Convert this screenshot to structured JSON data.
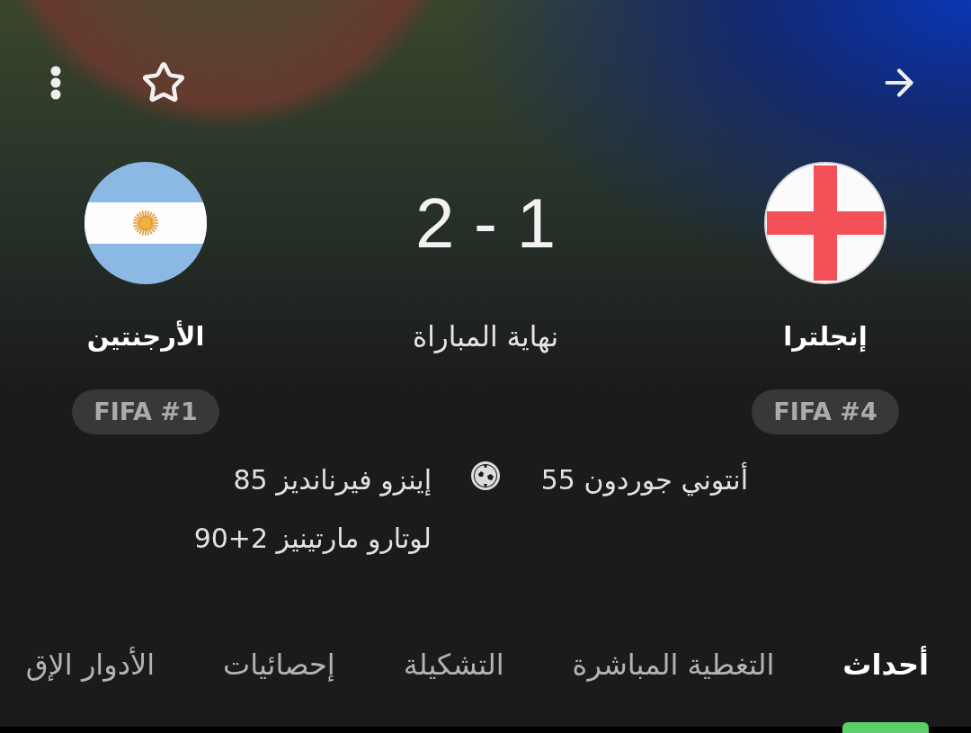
{
  "top_bar": {
    "starred": false
  },
  "teams": [
    {
      "kind": "england",
      "name": "إنجلترا",
      "rank": "FIFA #4",
      "scorers": [
        "أنتوني جوردون 55"
      ]
    },
    {
      "kind": "argentina",
      "name": "الأرجنتين",
      "rank": "FIFA #1",
      "scorers": [
        "إينزو فيرنانديز 85",
        "لوتارو مارتينيز 2+90"
      ]
    }
  ],
  "score": "2 - 1",
  "status": "نهاية المباراة",
  "tabs": [
    {
      "label": "أحداث",
      "selected": true
    },
    {
      "label": "التغطية المباشرة",
      "selected": false
    },
    {
      "label": "التشكيلة",
      "selected": false
    },
    {
      "label": "إحصائيات",
      "selected": false
    },
    {
      "label": "الأدوار الإق",
      "selected": false
    }
  ]
}
